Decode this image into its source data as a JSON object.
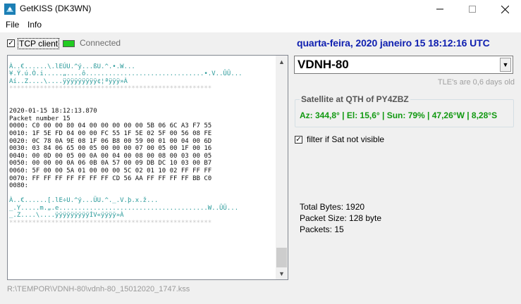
{
  "window": {
    "title": "GetKISS (DK3WN)",
    "icon": "satellite-dish-icon",
    "controls": [
      "minimize-icon",
      "maximize-icon",
      "close-icon"
    ]
  },
  "menu": {
    "file": "File",
    "info": "Info"
  },
  "connection": {
    "tcp_client_label": "TCP client",
    "tcp_client_checked": true,
    "status_label": "Connected",
    "status_color": "#22cc22"
  },
  "datetime": "quarta-feira, 2020 janeiro 15  18:12:16 UTC",
  "dump_lines": [
    {
      "c": "s",
      "t": " "
    },
    {
      "c": "p",
      "t": "À..€......\\.lEÚU.^ý...ßU.^.•.W..."
    },
    {
      "c": "p",
      "t": "¥.Ý.ú.Ò.i.....„....ô...............................•.V..ÛÛ..."
    },
    {
      "c": "p",
      "t": "Aí..Z....\\....ÿÿÿÿÿÿÿÿÿ¢¦ªÿÿÿ»À"
    },
    {
      "c": "s",
      "t": "*****************************************************"
    },
    {
      "c": "t",
      "t": " "
    },
    {
      "c": "t",
      "t": " "
    },
    {
      "c": "t",
      "t": "2020-01-15 18:12:13.870"
    },
    {
      "c": "t",
      "t": "Packet number 15"
    },
    {
      "c": "t",
      "t": "0000: C0 00 00 80 04 00 00 00 00 00 5B 06 6C A3 F7 55"
    },
    {
      "c": "t",
      "t": "0010: 1F 5E FD 04 00 00 FC 55 1F 5E 02 5F 00 56 08 FE"
    },
    {
      "c": "t",
      "t": "0020: 0C 78 0A 9E 08 1F 06 B8 00 59 00 01 00 04 00 6D"
    },
    {
      "c": "t",
      "t": "0030: 03 84 06 65 00 05 00 00 00 07 00 05 00 1F 00 16"
    },
    {
      "c": "t",
      "t": "0040: 00 0D 00 05 00 0A 00 04 00 08 00 08 00 03 00 05"
    },
    {
      "c": "t",
      "t": "0050: 00 00 00 0A 06 0B 0A 57 00 09 DB DC 10 03 00 B7"
    },
    {
      "c": "t",
      "t": "0060: 5F 00 00 5A 01 00 00 00 5C 02 01 10 02 FF FF FF"
    },
    {
      "c": "t",
      "t": "0070: FF FF FF FF FF FF FF CD 56 AA FF FF FF FF BB C0"
    },
    {
      "c": "t",
      "t": "0080:"
    },
    {
      "c": "t",
      "t": " "
    },
    {
      "c": "p",
      "t": "À..€......[.lE÷U.^ý...ÜU.^._.V.þ.x.ž..."
    },
    {
      "c": "p",
      "t": "_.Y.....m.„.e.......................................W..ÛÜ..."
    },
    {
      "c": "p",
      "t": "_.Z....\\....ÿÿÿÿÿÿÿÿÿÍV«ÿÿÿÿ»À"
    },
    {
      "c": "s",
      "t": "*****************************************************"
    }
  ],
  "satellite": {
    "selected": "VDNH-80",
    "tle_age": "TLE's are 0,6 days old",
    "group_title": "Satellite at QTH of PY4ZBZ",
    "info": "Az: 344,8° | El: 15,6° | Sun: 79% | 47,26°W | 8,28°S"
  },
  "filter": {
    "label": "filter if Sat not visible",
    "checked": true
  },
  "stats": {
    "total_bytes": "Total Bytes: 1920",
    "packet_size": "Packet Size: 128 byte",
    "packets": "Packets: 15"
  },
  "status_bar": "R:\\TEMPOR\\VDNH-80\\vdnh-80_15012020_1747.kss"
}
